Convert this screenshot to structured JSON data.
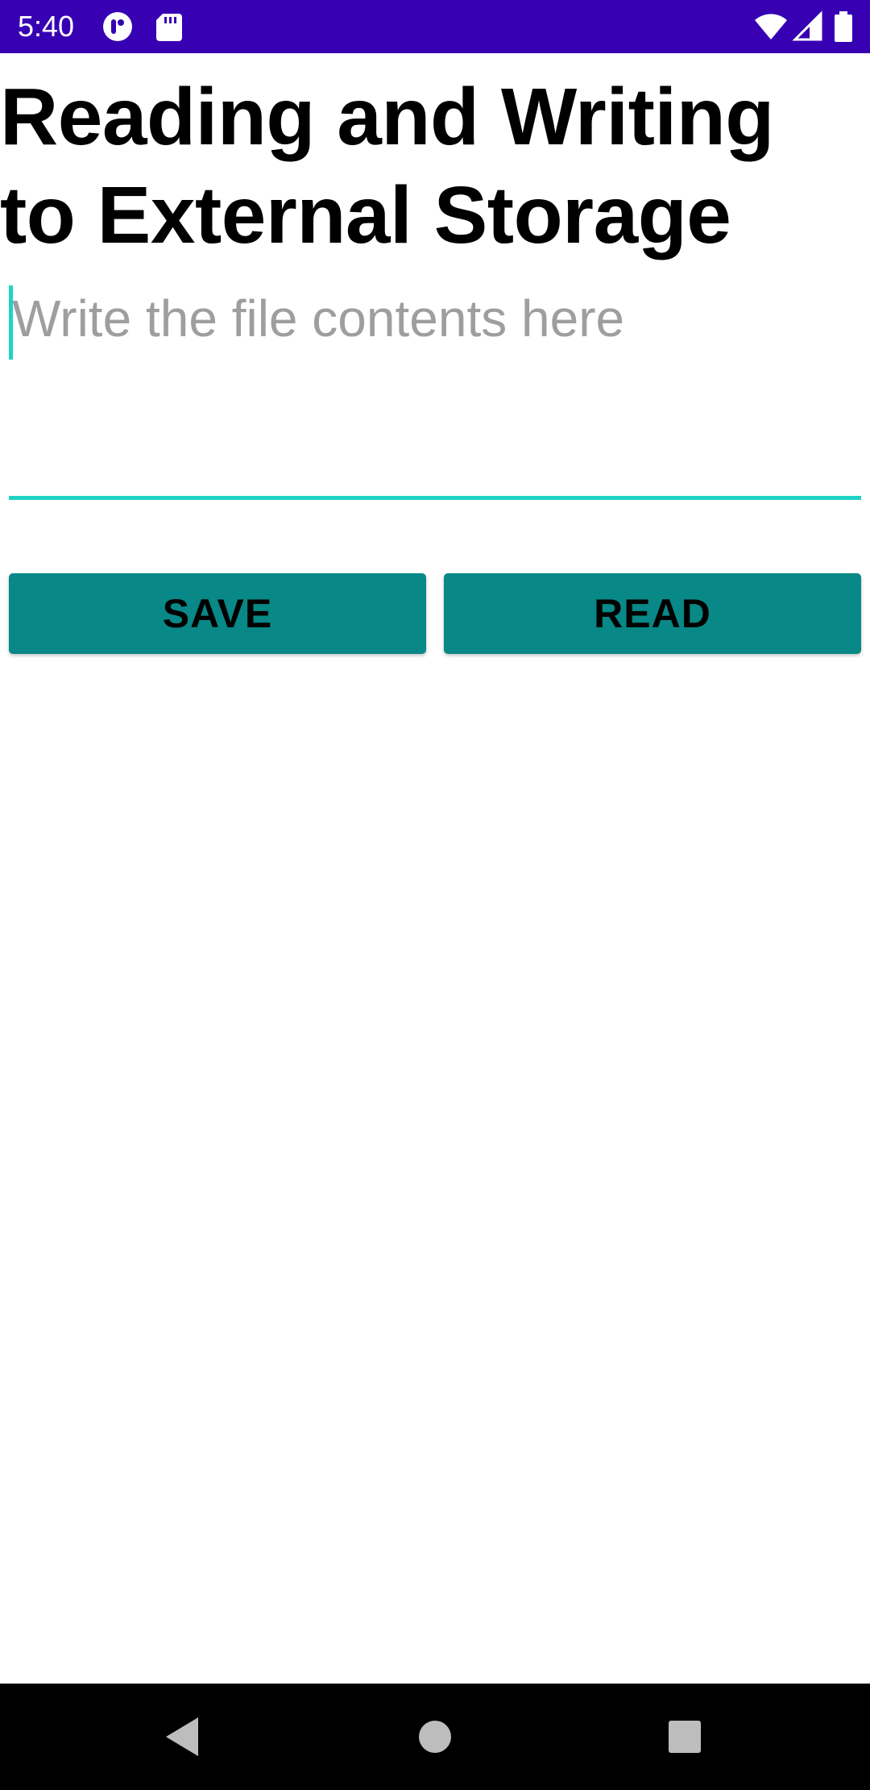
{
  "status_bar": {
    "time": "5:40",
    "left_icons": [
      "podcast-app-icon",
      "sd-card-icon"
    ],
    "right_icons": [
      "wifi-icon",
      "signal-icon",
      "battery-icon"
    ],
    "background_color": "#3700b3"
  },
  "header": {
    "title": "Reading and Writing to External Storage"
  },
  "editor": {
    "value": "",
    "placeholder": "Write the file contents here",
    "accent_color": "#1dd3c6"
  },
  "actions": {
    "save_label": "SAVE",
    "read_label": "READ",
    "button_color": "#088886"
  },
  "nav_bar": {
    "icons": [
      "back-icon",
      "home-icon",
      "recents-icon"
    ]
  }
}
